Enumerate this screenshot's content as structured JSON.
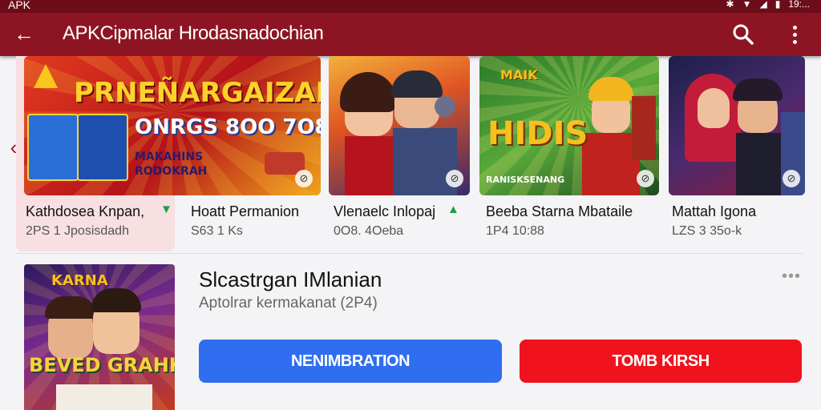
{
  "status_bar": {
    "left_text": "APK",
    "time": "19:..."
  },
  "app_bar": {
    "title": "APKCipmalar Hrodasnadochian",
    "icons": [
      "back-arrow-icon",
      "search-icon",
      "more-vert-icon"
    ]
  },
  "carousel": {
    "items": [
      {
        "title": "Kathdosea Knpan,",
        "meta": "2PS 1 Jposisdadh",
        "thumb_lines": [
          "PRNEÑARGAIZAN",
          "ONRGS 8OO 7O8",
          "MAKAHINS",
          "RODOKRAH"
        ],
        "colors": {
          "bg": "#c31a1a",
          "accent": "#f8c61c"
        },
        "selected": true,
        "verified": true
      },
      {
        "title": "Hoatt Permanion",
        "meta": "S63 1 Ks",
        "thumb_lines": [],
        "colors": {
          "bg": "#5b3a8e",
          "accent": "#f08b22"
        },
        "selected": false,
        "verified": false
      },
      {
        "title": "Vlenaelc Inlopaj",
        "meta": "0O8. 4Oeba",
        "thumb_lines": [],
        "colors": {
          "bg": "#1e6b3a",
          "accent": "#e33a24"
        },
        "selected": false,
        "verified": true
      },
      {
        "title": "Beeba Starna Mbataile",
        "meta": "1P4 10:88",
        "thumb_lines": [
          "MAIK",
          "HIDIS",
          "RANISKSENANG"
        ],
        "colors": {
          "bg": "#3b8d2a",
          "accent": "#f6c11d"
        },
        "selected": false,
        "verified": false
      },
      {
        "title": "Mattah Igona",
        "meta": "LZS 3 35o-k",
        "thumb_lines": [],
        "colors": {
          "bg": "#3a2a6e",
          "accent": "#c91e3a"
        },
        "selected": false,
        "verified": false
      }
    ]
  },
  "featured": {
    "title": "Slcastrgan IMlanian",
    "subtitle": "Aptolrar kermakanat (2P4)",
    "thumb_lines": [
      "KARNA",
      "BEVED GRAHKS"
    ],
    "primary_button": "NENIMBRATION",
    "secondary_button": "TOMB KIRSH",
    "colors": {
      "primary": "#2f6ef0",
      "secondary": "#f0121d"
    }
  }
}
